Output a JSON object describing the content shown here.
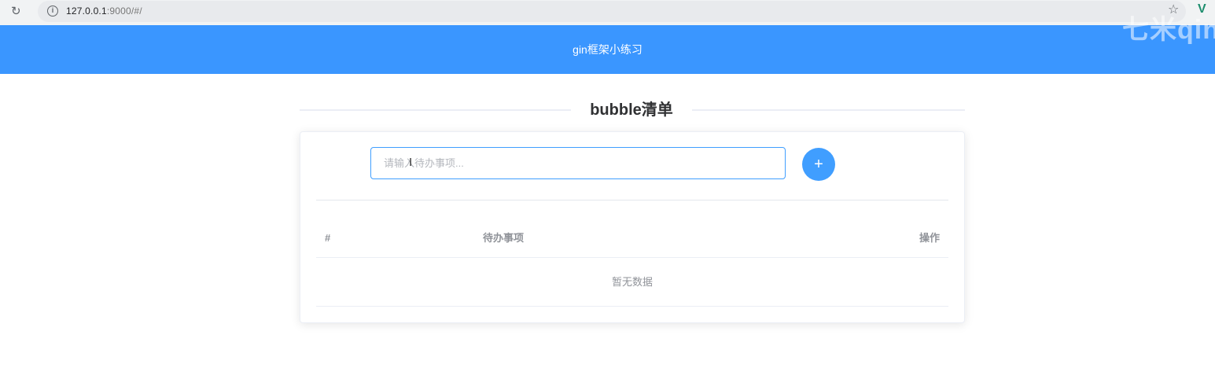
{
  "browser": {
    "url_host": "127.0.0.1",
    "url_rest": ":9000/#/",
    "icons": [
      "reload-icon",
      "info-icon",
      "star-icon",
      "extension-icon"
    ]
  },
  "header": {
    "title": "gin框架小练习",
    "watermark": "七米qin",
    "background_color": "#3a96ff"
  },
  "main": {
    "section_title": "bubble清单",
    "input": {
      "placeholder": "请输入待办事项...",
      "value": ""
    },
    "add_button": {
      "label": "+",
      "color": "#409eff"
    },
    "table": {
      "columns": [
        "#",
        "待办事项",
        "操作"
      ],
      "rows": [],
      "empty_text": "暂无数据"
    }
  }
}
